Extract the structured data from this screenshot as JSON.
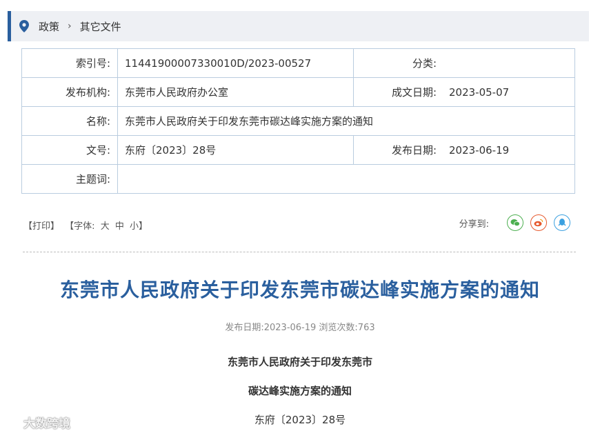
{
  "breadcrumb": {
    "item1": "政策",
    "sep": "›",
    "item2": "其它文件"
  },
  "meta": {
    "index_label": "索引号:",
    "index_value": "11441900007330010D/2023-00527",
    "category_label": "分类:",
    "category_value": "",
    "org_label": "发布机构:",
    "org_value": "东莞市人民政府办公室",
    "created_label": "成文日期:",
    "created_value": "2023-05-07",
    "name_label": "名称:",
    "name_value": "东莞市人民政府关于印发东莞市碳达峰实施方案的通知",
    "docno_label": "文号:",
    "docno_value": "东府〔2023〕28号",
    "pub_label": "发布日期:",
    "pub_value": "2023-06-19",
    "subject_label": "主题词:",
    "subject_value": ""
  },
  "tools": {
    "print": "【打印】",
    "font_open": "【字体:",
    "font_large": "大",
    "font_mid": "中",
    "font_small": "小】"
  },
  "share": {
    "label": "分享到:",
    "icons": [
      "wechat-icon",
      "weibo-icon",
      "qq-icon"
    ]
  },
  "article": {
    "title": "东莞市人民政府关于印发东莞市碳达峰实施方案的通知",
    "info": "发布日期:2023-06-19  浏览次数:763",
    "line1": "东莞市人民政府关于印发东莞市",
    "line2": "碳达峰实施方案的通知",
    "line3": "东府〔2023〕28号"
  },
  "watermark": "大数跨境",
  "colors": {
    "accent": "#2a5f9e",
    "wechat": "#4caf50",
    "weibo": "#e6582c",
    "qq": "#3aa0e0"
  }
}
